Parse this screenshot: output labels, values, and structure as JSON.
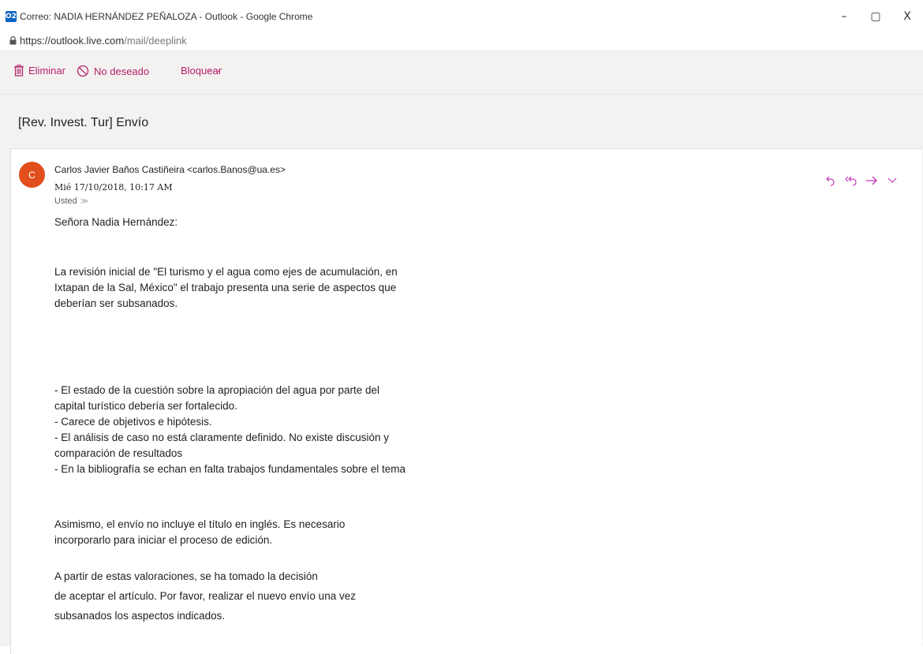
{
  "window": {
    "title": "Correo: NADIA HERNÁNDEZ PEÑALOZA - Outlook - Google Chrome",
    "app_icon": "O2",
    "controls": {
      "minimize": "–",
      "restore": "▢",
      "close": "X"
    }
  },
  "address": {
    "host": "https://outlook.live.com",
    "path": "/mail/deeplink"
  },
  "toolbar": {
    "delete_label": "Eliminar",
    "junk_label": "No deseado",
    "block_label": "Bloquear",
    "more_label": "···"
  },
  "message": {
    "subject": "[Rev. Invest. Tur] Envío",
    "avatar_initial": "C",
    "sender": "Carlos Javier Baños Castiñeira <carlos.Banos@ua.es>",
    "date": "Mié 17/10/2018, 10:17 AM",
    "to": "Usted",
    "body": {
      "greeting": "Señora Nadia Hernández:",
      "para1": [
        "La revisión inicial de \"El turismo y el agua como ejes de acumulación, en",
        "Ixtapan de la Sal, México\" el trabajo presenta una serie de aspectos que",
        "deberían ser subsanados."
      ],
      "points": [
        "- El estado de la cuestión sobre la apropiación del agua por parte del",
        "capital turístico debería ser fortalecido.",
        "- Carece de objetivos e hipótesis.",
        "- El análisis de caso no está claramente definido. No existe discusión y",
        "comparación de resultados",
        "- En la bibliografía se echan en falta trabajos fundamentales sobre el tema"
      ],
      "para2": [
        "Asimismo, el envío no incluye el título en inglés. Es necesario",
        "incorporarlo para iniciar el proceso de edición."
      ],
      "para3": [
        "A partir de estas valoraciones, se ha tomado la decisión",
        "de aceptar el artículo. Por favor, realizar el nuevo envío una vez",
        "subsanados los aspectos indicados."
      ]
    }
  },
  "colors": {
    "accent": "#b4206a",
    "avatar": "#e24f1c",
    "pane_bg": "#f3f2f1"
  }
}
